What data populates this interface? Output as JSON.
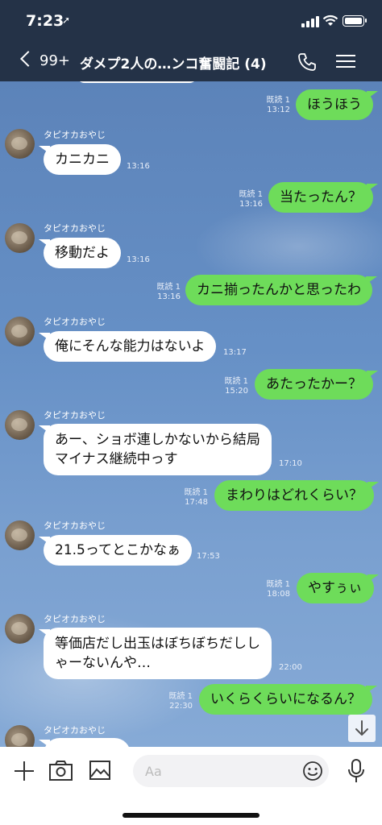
{
  "status_bar": {
    "time": "7:23",
    "location_glyph": "➚"
  },
  "header": {
    "back_count": "99+",
    "title": "ダメプ2人の…ンコ奮闘記 (4)"
  },
  "messages": [
    {
      "side": "me",
      "text": "ほうほう",
      "read": "既読 1",
      "time": "13:12"
    },
    {
      "side": "them",
      "sender": "タピオカおやじ",
      "text": "カニカニ",
      "time": "13:16"
    },
    {
      "side": "me",
      "text": "当たったん？",
      "read": "既読 1",
      "time": "13:16"
    },
    {
      "side": "them",
      "sender": "タピオカおやじ",
      "text": "移動だよ",
      "time": "13:16"
    },
    {
      "side": "me",
      "text": "カニ揃ったんかと思ったわ",
      "read": "既読 1",
      "time": "13:16"
    },
    {
      "side": "them",
      "sender": "タピオカおやじ",
      "text": "俺にそんな能力はないよ",
      "time": "13:17"
    },
    {
      "side": "me",
      "text": "あたったかー？",
      "read": "既読 1",
      "time": "15:20"
    },
    {
      "side": "them",
      "sender": "タピオカおやじ",
      "lines": [
        "あー、ショボ連しかないから結局",
        "マイナス継続中っす"
      ],
      "time": "17:10"
    },
    {
      "side": "me",
      "text": "まわりはどれくらい？",
      "read": "既読 1",
      "time": "17:48"
    },
    {
      "side": "them",
      "sender": "タピオカおやじ",
      "text": "21.5ってとこかなぁ",
      "time": "17:53"
    },
    {
      "side": "me",
      "text": "やすぅぃ",
      "read": "既読 1",
      "time": "18:08"
    },
    {
      "side": "them",
      "sender": "タピオカおやじ",
      "lines": [
        "等価店だし出玉はぼちぼちだしし",
        "ゃーないんや…"
      ],
      "time": "22:00"
    },
    {
      "side": "me",
      "text": "いくらくらいになるん？",
      "read": "既読 1",
      "time": "22:30"
    },
    {
      "side": "them",
      "sender": "タピオカおやじ"
    }
  ],
  "input": {
    "placeholder": "Aa"
  },
  "colors": {
    "header_bg": "#243247",
    "my_bubble": "#6edc5a",
    "their_bubble": "#ffffff"
  },
  "icons": [
    "location-arrow-icon",
    "signal-icon",
    "wifi-icon",
    "battery-icon",
    "back-chevron-icon",
    "phone-icon",
    "menu-icon",
    "scroll-down-arrow-icon",
    "plus-icon",
    "camera-icon",
    "image-icon",
    "emoji-icon",
    "microphone-icon"
  ]
}
